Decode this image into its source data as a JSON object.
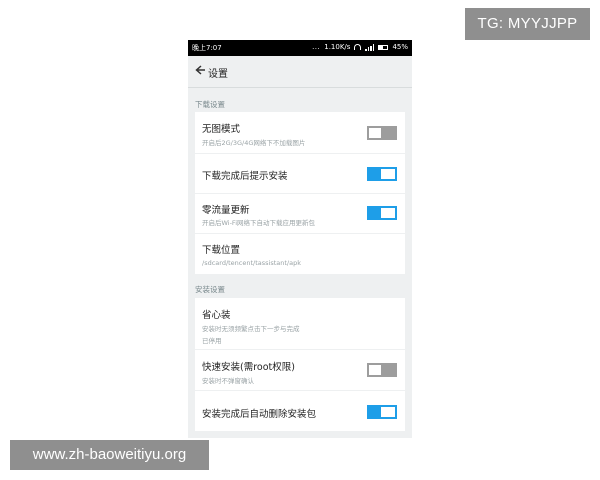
{
  "watermarks": {
    "top": "TG: MYYJJPP",
    "bottom": "www.zh-baoweitiyu.org"
  },
  "status_bar": {
    "time": "晚上7:07",
    "signal_dots": "...",
    "speed": "1.10K/s",
    "battery": "45%"
  },
  "app_bar": {
    "back_icon": "back-arrow-icon",
    "title": "设置"
  },
  "sections": {
    "download": {
      "header": "下载设置",
      "items": [
        {
          "title": "无图模式",
          "subtitle": "开启后2G/3G/4G网络下不加载图片",
          "toggle": "off"
        },
        {
          "title": "下载完成后提示安装",
          "toggle": "on"
        },
        {
          "title": "零流量更新",
          "subtitle": "开启后Wi-Fi网络下自动下载应用更新包",
          "toggle": "on"
        },
        {
          "title": "下载位置",
          "subtitle": "/sdcard/tencent/tassistant/apk"
        }
      ]
    },
    "install": {
      "header": "安装设置",
      "items": [
        {
          "title": "省心装",
          "subtitle": "安装时无须频繁点击下一步与完成",
          "subtitle2": "已停用"
        },
        {
          "title": "快速安装(需root权限)",
          "subtitle": "安装时不弹窗确认",
          "toggle": "off"
        },
        {
          "title": "安装完成后自动删除安装包",
          "toggle": "on"
        }
      ]
    }
  },
  "colors": {
    "accent": "#1e9ee8",
    "toggle_off": "#9d9d9d",
    "background": "#eef0f1",
    "statusbar": "#000000"
  }
}
